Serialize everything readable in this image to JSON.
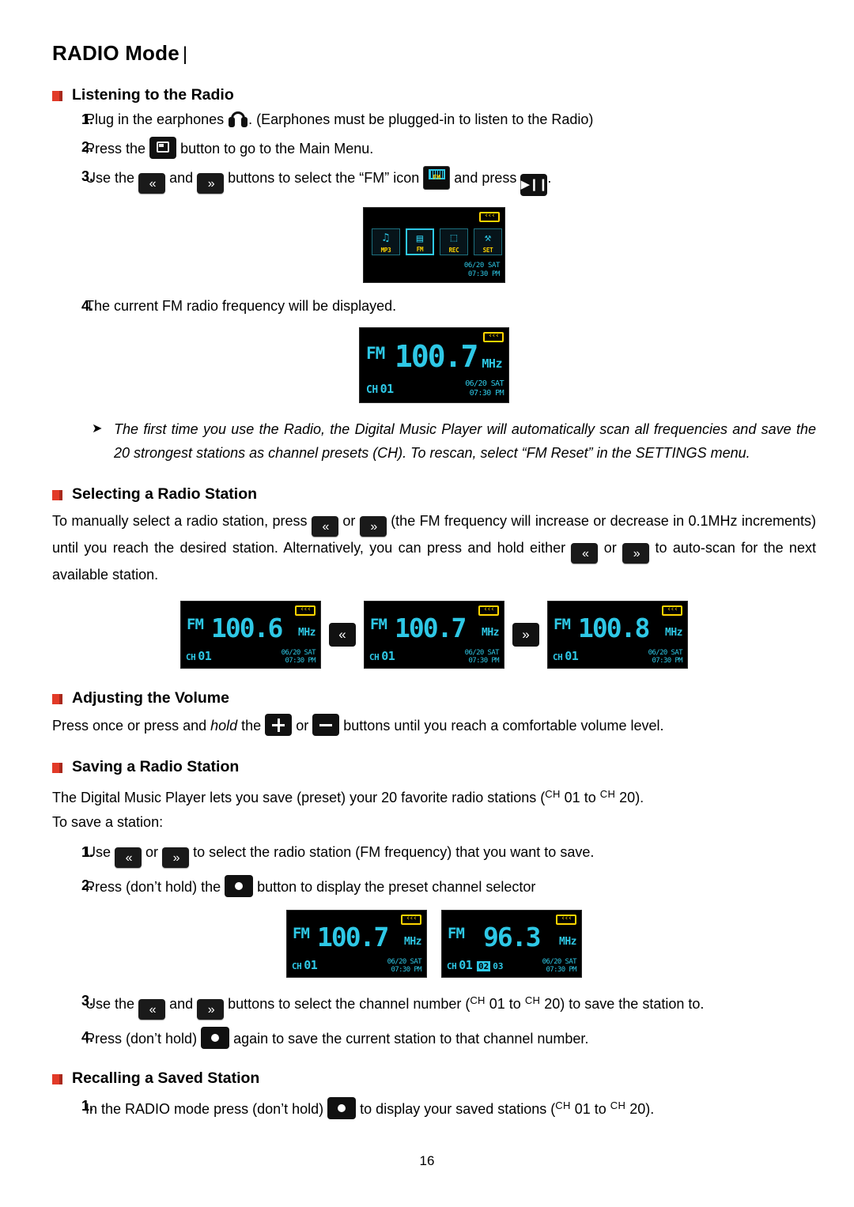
{
  "page": {
    "title": "RADIO Mode",
    "title_suffix": "|",
    "number": "16"
  },
  "sections": {
    "listening": {
      "heading": "Listening to the Radio",
      "steps": [
        {
          "num": "1.",
          "text_a": "Plug in the earphones",
          "text_b": ". (Earphones must be plugged-in to listen to the Radio)"
        },
        {
          "num": "2.",
          "text_a": "Press the",
          "text_b": "button to go to the Main Menu."
        },
        {
          "num": "3.",
          "text_a": "Use the",
          "text_b": "and",
          "text_c": "buttons to select the “FM” icon",
          "text_d": "and press",
          "text_e": "."
        },
        {
          "num": "4.",
          "text_a": "The current FM radio frequency will be displayed."
        }
      ]
    },
    "note": {
      "arrow": "➤",
      "text": "The first time you use the Radio, the Digital Music Player will automatically scan all frequencies and save the 20 strongest stations as channel presets (CH). To rescan, select “FM Reset” in the SETTINGS menu."
    },
    "selecting": {
      "heading": "Selecting a Radio Station",
      "para_a": "To manually select a radio station, press",
      "para_or1": "or",
      "para_b": "(the FM frequency will increase or decrease in 0.1MHz increments) until you reach the desired station. Alternatively, you can press and hold either",
      "para_or2": "or",
      "para_c": "to auto-scan for the next available station."
    },
    "volume": {
      "heading": "Adjusting the Volume",
      "para_a": "Press once or press and",
      "hold": "hold",
      "para_b": "the",
      "para_or": "or",
      "para_c": "buttons until you reach a comfortable volume level."
    },
    "saving": {
      "heading": "Saving a Radio Station",
      "para_a": "The Digital Music Player lets you save (preset) your 20 favorite radio stations (",
      "ch_sup1": "CH",
      "ch_01": "01",
      "to": "to",
      "ch_sup2": "CH",
      "ch_20": "20",
      "para_b": ").",
      "para_c": "To save a station:",
      "steps": [
        {
          "num": "1.",
          "text_a": "Use",
          "text_or": "or",
          "text_b": "to select the radio station (FM frequency) that you want to save."
        },
        {
          "num": "2.",
          "text_a": "Press (don’t hold) the",
          "text_b": "button to display the preset channel selector"
        },
        {
          "num": "3.",
          "text_a": "Use the",
          "text_and": "and",
          "text_b": "buttons to select the channel number (",
          "ch_sup1": "CH",
          "ch_01": "01",
          "to": "to",
          "ch_sup2": "CH",
          "ch_20": "20",
          "text_c": ") to save the station to."
        },
        {
          "num": "4.",
          "text_a": "Press (don’t hold)",
          "text_b": "again to save the current station to that channel number."
        }
      ]
    },
    "recalling": {
      "heading": "Recalling a Saved Station",
      "steps": [
        {
          "num": "1.",
          "text_a": "In the RADIO mode press (don’t hold)",
          "text_b": "to display your saved stations (",
          "ch_sup1": "CH",
          "ch_01": "01",
          "to": "to",
          "ch_sup2": "CH",
          "ch_20": "20",
          "text_c": ")."
        }
      ]
    }
  },
  "screens": {
    "main_menu": {
      "battery": "‹‹‹",
      "items": [
        {
          "label": "MP3",
          "symbol": "♫",
          "selected": false
        },
        {
          "label": "FM",
          "symbol": "▤",
          "selected": true
        },
        {
          "label": "REC",
          "symbol": "⬚",
          "selected": false
        },
        {
          "label": "SET",
          "symbol": "⚒",
          "selected": false
        }
      ],
      "date": "06/20 SAT",
      "time": "07:30 PM"
    },
    "fm_current": {
      "fm": "FM",
      "freq": "100.7",
      "unit": "MHz",
      "ch_label": "CH",
      "ch_num": "01",
      "battery": "‹‹‹",
      "date": "06/20 SAT",
      "time": "07:30 PM"
    },
    "tune_row": [
      {
        "fm": "FM",
        "freq": "100.6",
        "unit": "MHz",
        "ch_label": "CH",
        "ch_num": "01",
        "battery": "‹‹‹",
        "date": "06/20 SAT",
        "time": "07:30 PM"
      },
      {
        "fm": "FM",
        "freq": "100.7",
        "unit": "MHz",
        "ch_label": "CH",
        "ch_num": "01",
        "battery": "‹‹‹",
        "date": "06/20 SAT",
        "time": "07:30 PM"
      },
      {
        "fm": "FM",
        "freq": "100.8",
        "unit": "MHz",
        "ch_label": "CH",
        "ch_num": "01",
        "battery": "‹‹‹",
        "date": "06/20 SAT",
        "time": "07:30 PM"
      }
    ],
    "tune_keys": {
      "prev": "«",
      "next": "»"
    },
    "preset_row": [
      {
        "fm": "FM",
        "freq": "100.7",
        "unit": "MHz",
        "ch_label": "CH",
        "ch_num": "01",
        "battery": "‹‹‹",
        "date": "06/20 SAT",
        "time": "07:30 PM"
      },
      {
        "fm": "FM",
        "freq": "96.3",
        "unit": "MHz",
        "ch_label": "CH",
        "ch_num": "01",
        "battery": "‹‹‹",
        "date": "06/20 SAT",
        "time": "07:30 PM",
        "presets": [
          "02",
          "03"
        ],
        "preset_selected": "02"
      }
    ]
  },
  "icons": {
    "prev_key": "«",
    "next_key": "»",
    "play_key": "▶❙❙",
    "menu_key": "menu",
    "rec_key": "rec",
    "plus_key": "+",
    "minus_key": "−",
    "earphones": "earphones",
    "fm_tile": "FM"
  },
  "colors": {
    "bullet": "#e23a28",
    "lcd_cyan": "#2ec8e6",
    "lcd_yellow": "#ffd400"
  }
}
